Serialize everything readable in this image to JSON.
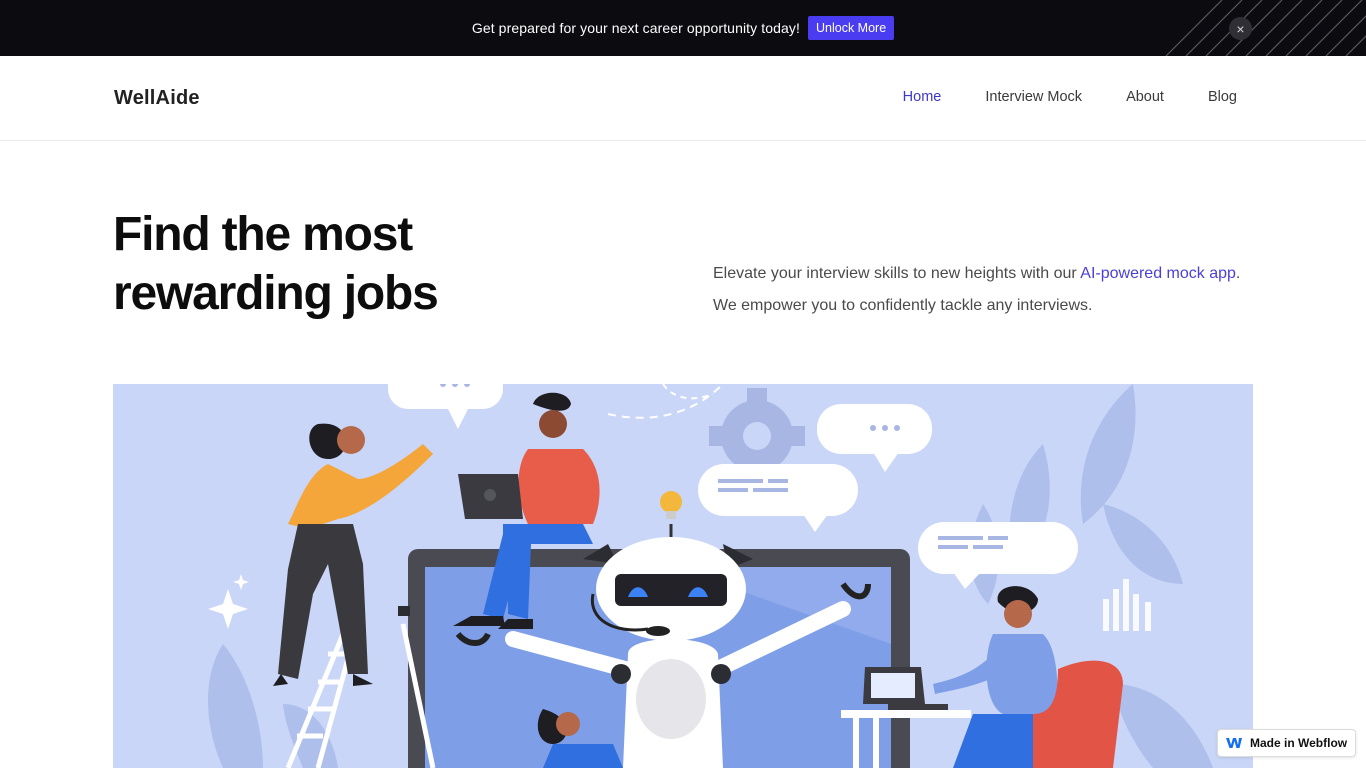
{
  "announcement": {
    "text": "Get prepared for your next career opportunity today!",
    "button_label": "Unlock More",
    "close_symbol": "×"
  },
  "nav": {
    "logo": "WellAide",
    "links": [
      {
        "label": "Home",
        "active": true
      },
      {
        "label": "Interview Mock",
        "active": false
      },
      {
        "label": "About",
        "active": false
      },
      {
        "label": "Blog",
        "active": false
      }
    ]
  },
  "hero": {
    "title": "Find the most rewarding jobs",
    "desc_before": "Elevate your interview skills to new heights with our ",
    "desc_link": "AI-powered mock app",
    "desc_after": ". We empower you to confidently tackle any interviews."
  },
  "illustration": {
    "name": "hero-illustration-robot-and-people",
    "background": "#c9d6f7"
  },
  "badge": {
    "label": "Made in Webflow",
    "icon": "webflow-icon"
  },
  "colors": {
    "accent": "#4a3cf0",
    "nav_active": "#3f37c9",
    "link": "#4a3fd6"
  }
}
